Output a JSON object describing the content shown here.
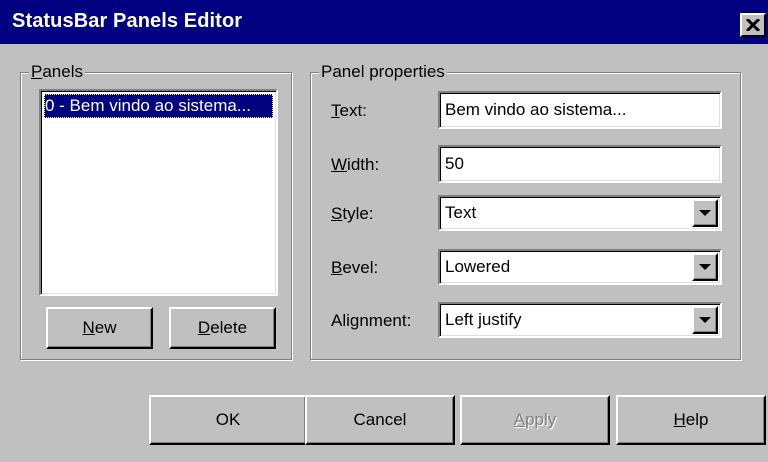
{
  "window": {
    "title": "StatusBar Panels Editor",
    "close_glyph": "✕"
  },
  "panels_group": {
    "label_mnemonic": "P",
    "label_rest": "anels",
    "items": [
      {
        "label": "0 - Bem vindo ao sistema...",
        "selected": true
      }
    ],
    "new_button": {
      "mnemonic": "N",
      "rest": "ew"
    },
    "delete_button": {
      "mnemonic": "D",
      "rest": "elete"
    }
  },
  "properties_group": {
    "label": "Panel properties",
    "text": {
      "label_mnemonic": "T",
      "label_rest": "ext:",
      "value": "Bem vindo ao sistema..."
    },
    "width": {
      "label_mnemonic": "W",
      "label_rest": "idth:",
      "value": "50"
    },
    "style": {
      "label_mnemonic": "S",
      "label_rest": "tyle:",
      "value": "Text"
    },
    "bevel": {
      "label_mnemonic": "B",
      "label_rest": "evel:",
      "value": "Lowered"
    },
    "alignment": {
      "label": "Alignment:",
      "value": "Left justify"
    }
  },
  "buttons": {
    "ok": "OK",
    "cancel": "Cancel",
    "apply": {
      "mnemonic": "A",
      "rest": "pply",
      "disabled": true
    },
    "help": {
      "mnemonic": "H",
      "rest": "elp"
    }
  },
  "icons": {
    "close": "close-icon",
    "dropdown": "chevron-down-icon"
  }
}
